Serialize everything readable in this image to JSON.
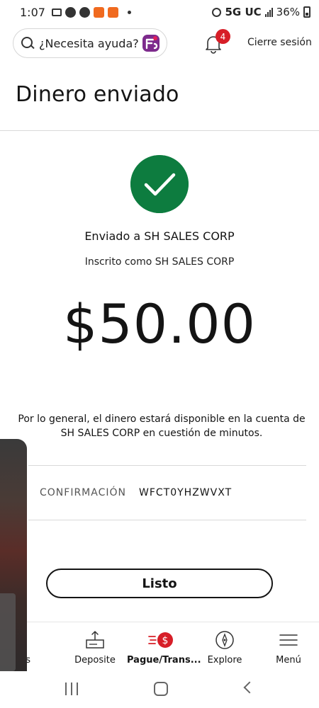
{
  "status_bar": {
    "time": "1:07",
    "network": "5G UC",
    "battery": "36%"
  },
  "header": {
    "search_placeholder": "¿Necesita ayuda?",
    "notification_count": "4",
    "signout_label": "Cierre sesión"
  },
  "page": {
    "title": "Dinero enviado",
    "sent_to": "Enviado a SH SALES CORP",
    "enrolled_as": "Inscrito como SH SALES CORP",
    "amount": "$50.00",
    "availability_line1": "Por lo general, el dinero estará disponible en la cuenta de",
    "availability_line2": "SH SALES CORP en cuestión de minutos.",
    "confirmation_label": "CONFIRMACIÓN",
    "confirmation_value": "WFCT0YHZWVXT",
    "done_label": "Listo"
  },
  "bottom_nav": {
    "items": [
      {
        "label": "entas",
        "icon": "home-icon"
      },
      {
        "label": "Deposite",
        "icon": "deposit-icon"
      },
      {
        "label": "Pague/Trans...",
        "icon": "pay-transfer-icon",
        "active": true
      },
      {
        "label": "Explore",
        "icon": "compass-icon"
      },
      {
        "label": "Menú",
        "icon": "menu-icon"
      }
    ]
  },
  "colors": {
    "success": "#0d7c3f",
    "badge": "#d71e28",
    "text": "#141414"
  }
}
